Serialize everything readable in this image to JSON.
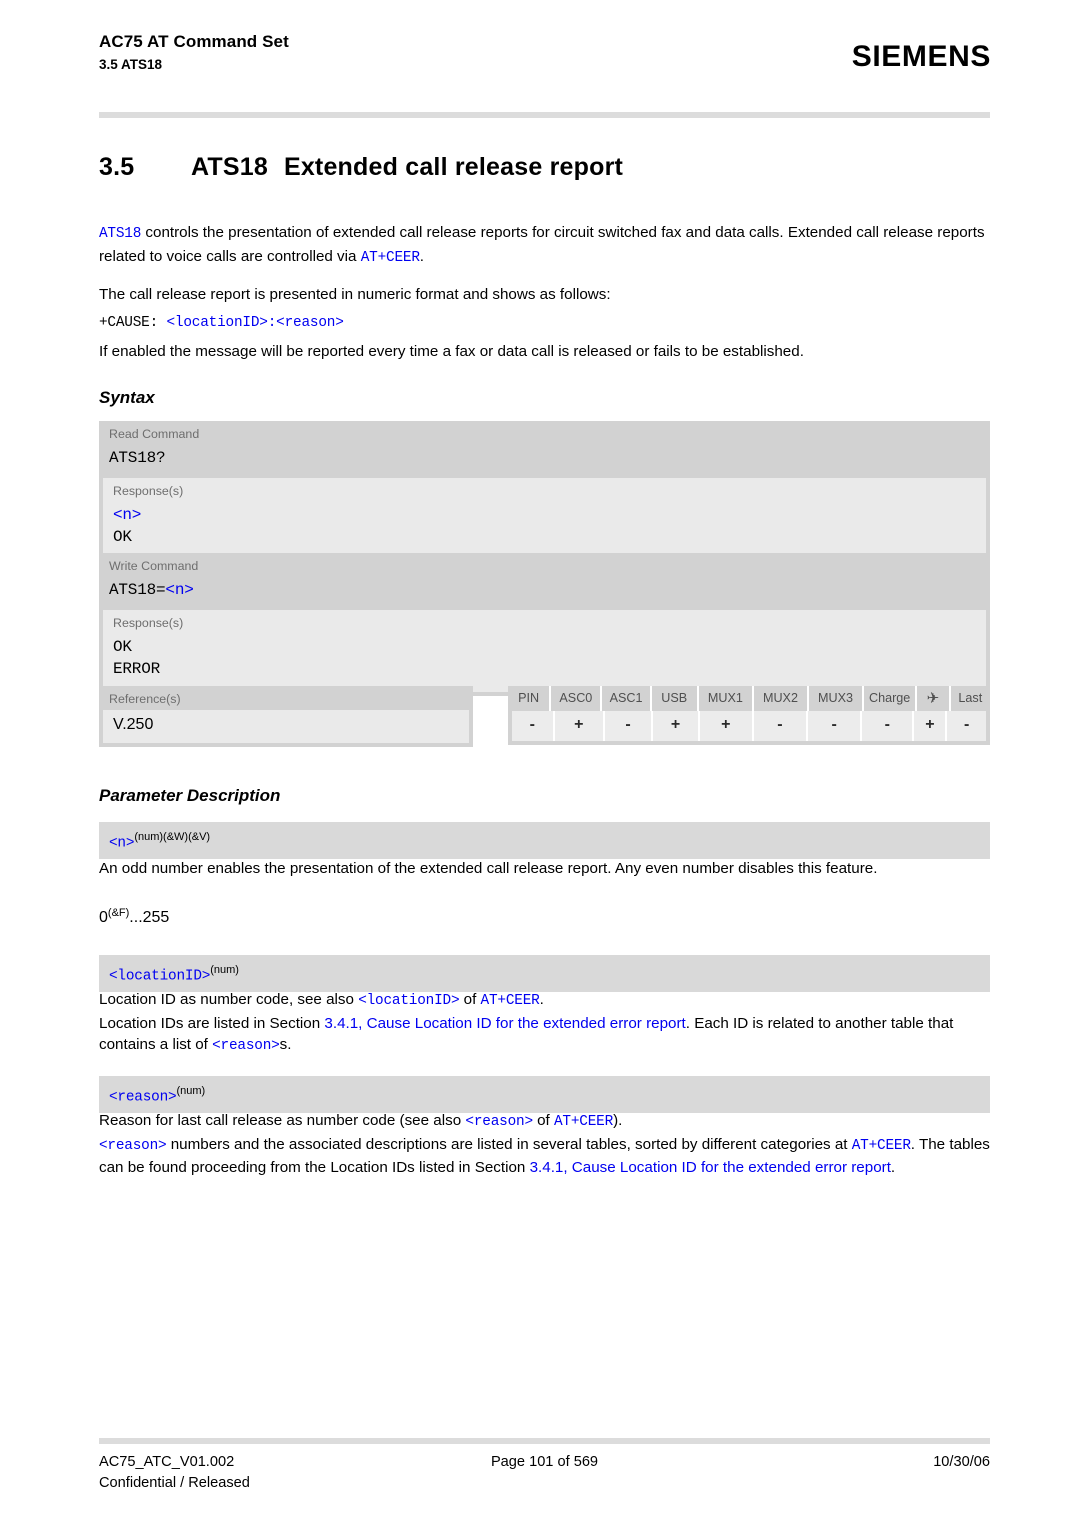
{
  "header": {
    "title": "AC75 AT Command Set",
    "subtitle": "3.5 ATS18",
    "logo": "SIEMENS"
  },
  "section": {
    "number": "3.5",
    "command": "ATS18",
    "title": "Extended call release report"
  },
  "intro": {
    "p1_cmd": "ATS18",
    "p1_text": " controls the presentation of extended call release reports for circuit switched fax and data calls. Extended call release reports related to voice calls are controlled via ",
    "p1_link": "AT+CEER",
    "p1_end": ".",
    "p2": "The call release report is presented in numeric format and shows as follows:",
    "report_prefix": "+CAUSE: ",
    "report_params": "<locationID>:<reason>",
    "p3": "If enabled the message will be reported every time a fax or data call is released or fails to be established."
  },
  "syntax": {
    "heading": "Syntax",
    "read": {
      "label": "Read Command",
      "command": "ATS18?",
      "response_label": "Response(s)",
      "response_param": "<n>",
      "response_ok": "OK"
    },
    "write": {
      "label": "Write Command",
      "command_prefix": "ATS18=",
      "command_param": "<n>",
      "response_label": "Response(s)",
      "response_ok": "OK",
      "response_error": "ERROR"
    },
    "reference": {
      "label": "Reference(s)",
      "value": "V.250"
    },
    "capabilities": {
      "columns": [
        "PIN",
        "ASC0",
        "ASC1",
        "USB",
        "MUX1",
        "MUX2",
        "MUX3",
        "Charge",
        "airplane-icon",
        "Last"
      ],
      "values": [
        "-",
        "+",
        "-",
        "+",
        "+",
        "-",
        "-",
        "-",
        "+",
        "-"
      ],
      "airplane_glyph": "✈"
    }
  },
  "parameters": {
    "heading": "Parameter Description",
    "items": [
      {
        "name": "<n>",
        "sup": "(num)(&W)(&V)",
        "desc_lines": [
          "An odd number enables the presentation of the extended call release report. Any even number disables this feature."
        ],
        "range_value": "0",
        "range_sup": "(&F)",
        "range_end": "...255"
      },
      {
        "name": "<locationID>",
        "sup": "(num)",
        "line1_a": "Location ID as number code, see also ",
        "line1_param": "<locationID>",
        "line1_b": " of ",
        "line1_link": "AT+CEER",
        "line1_c": ".",
        "line2_a": "Location IDs are listed in Section ",
        "line2_link": "3.4.1, Cause Location ID for the extended error report",
        "line2_b": ". Each ID is related to another table that contains a list of ",
        "line2_param": "<reason>",
        "line2_c": "s."
      },
      {
        "name": "<reason>",
        "sup": "(num)",
        "line1_a": "Reason for last call release as number code (see also ",
        "line1_param": "<reason>",
        "line1_b": " of ",
        "line1_link": "AT+CEER",
        "line1_c": ").",
        "line2_param": "<reason>",
        "line2_a": " numbers and the associated descriptions are listed in several tables, sorted by different categories at ",
        "line2_link1": "AT+CEER",
        "line2_b": ". The tables can be found proceeding from the Location IDs listed in Section ",
        "line2_link2": "3.4.1, Cause Location ID for the extended error report",
        "line2_c": "."
      }
    ]
  },
  "footer": {
    "doc_id": "AC75_ATC_V01.002",
    "page": "Page 101 of 569",
    "date": "10/30/06",
    "classification": "Confidential / Released"
  },
  "colors": {
    "link": "#0000f0",
    "rule": "#dcdcdc",
    "block": "#d2d2d2",
    "block_light": "#eaeaea"
  }
}
